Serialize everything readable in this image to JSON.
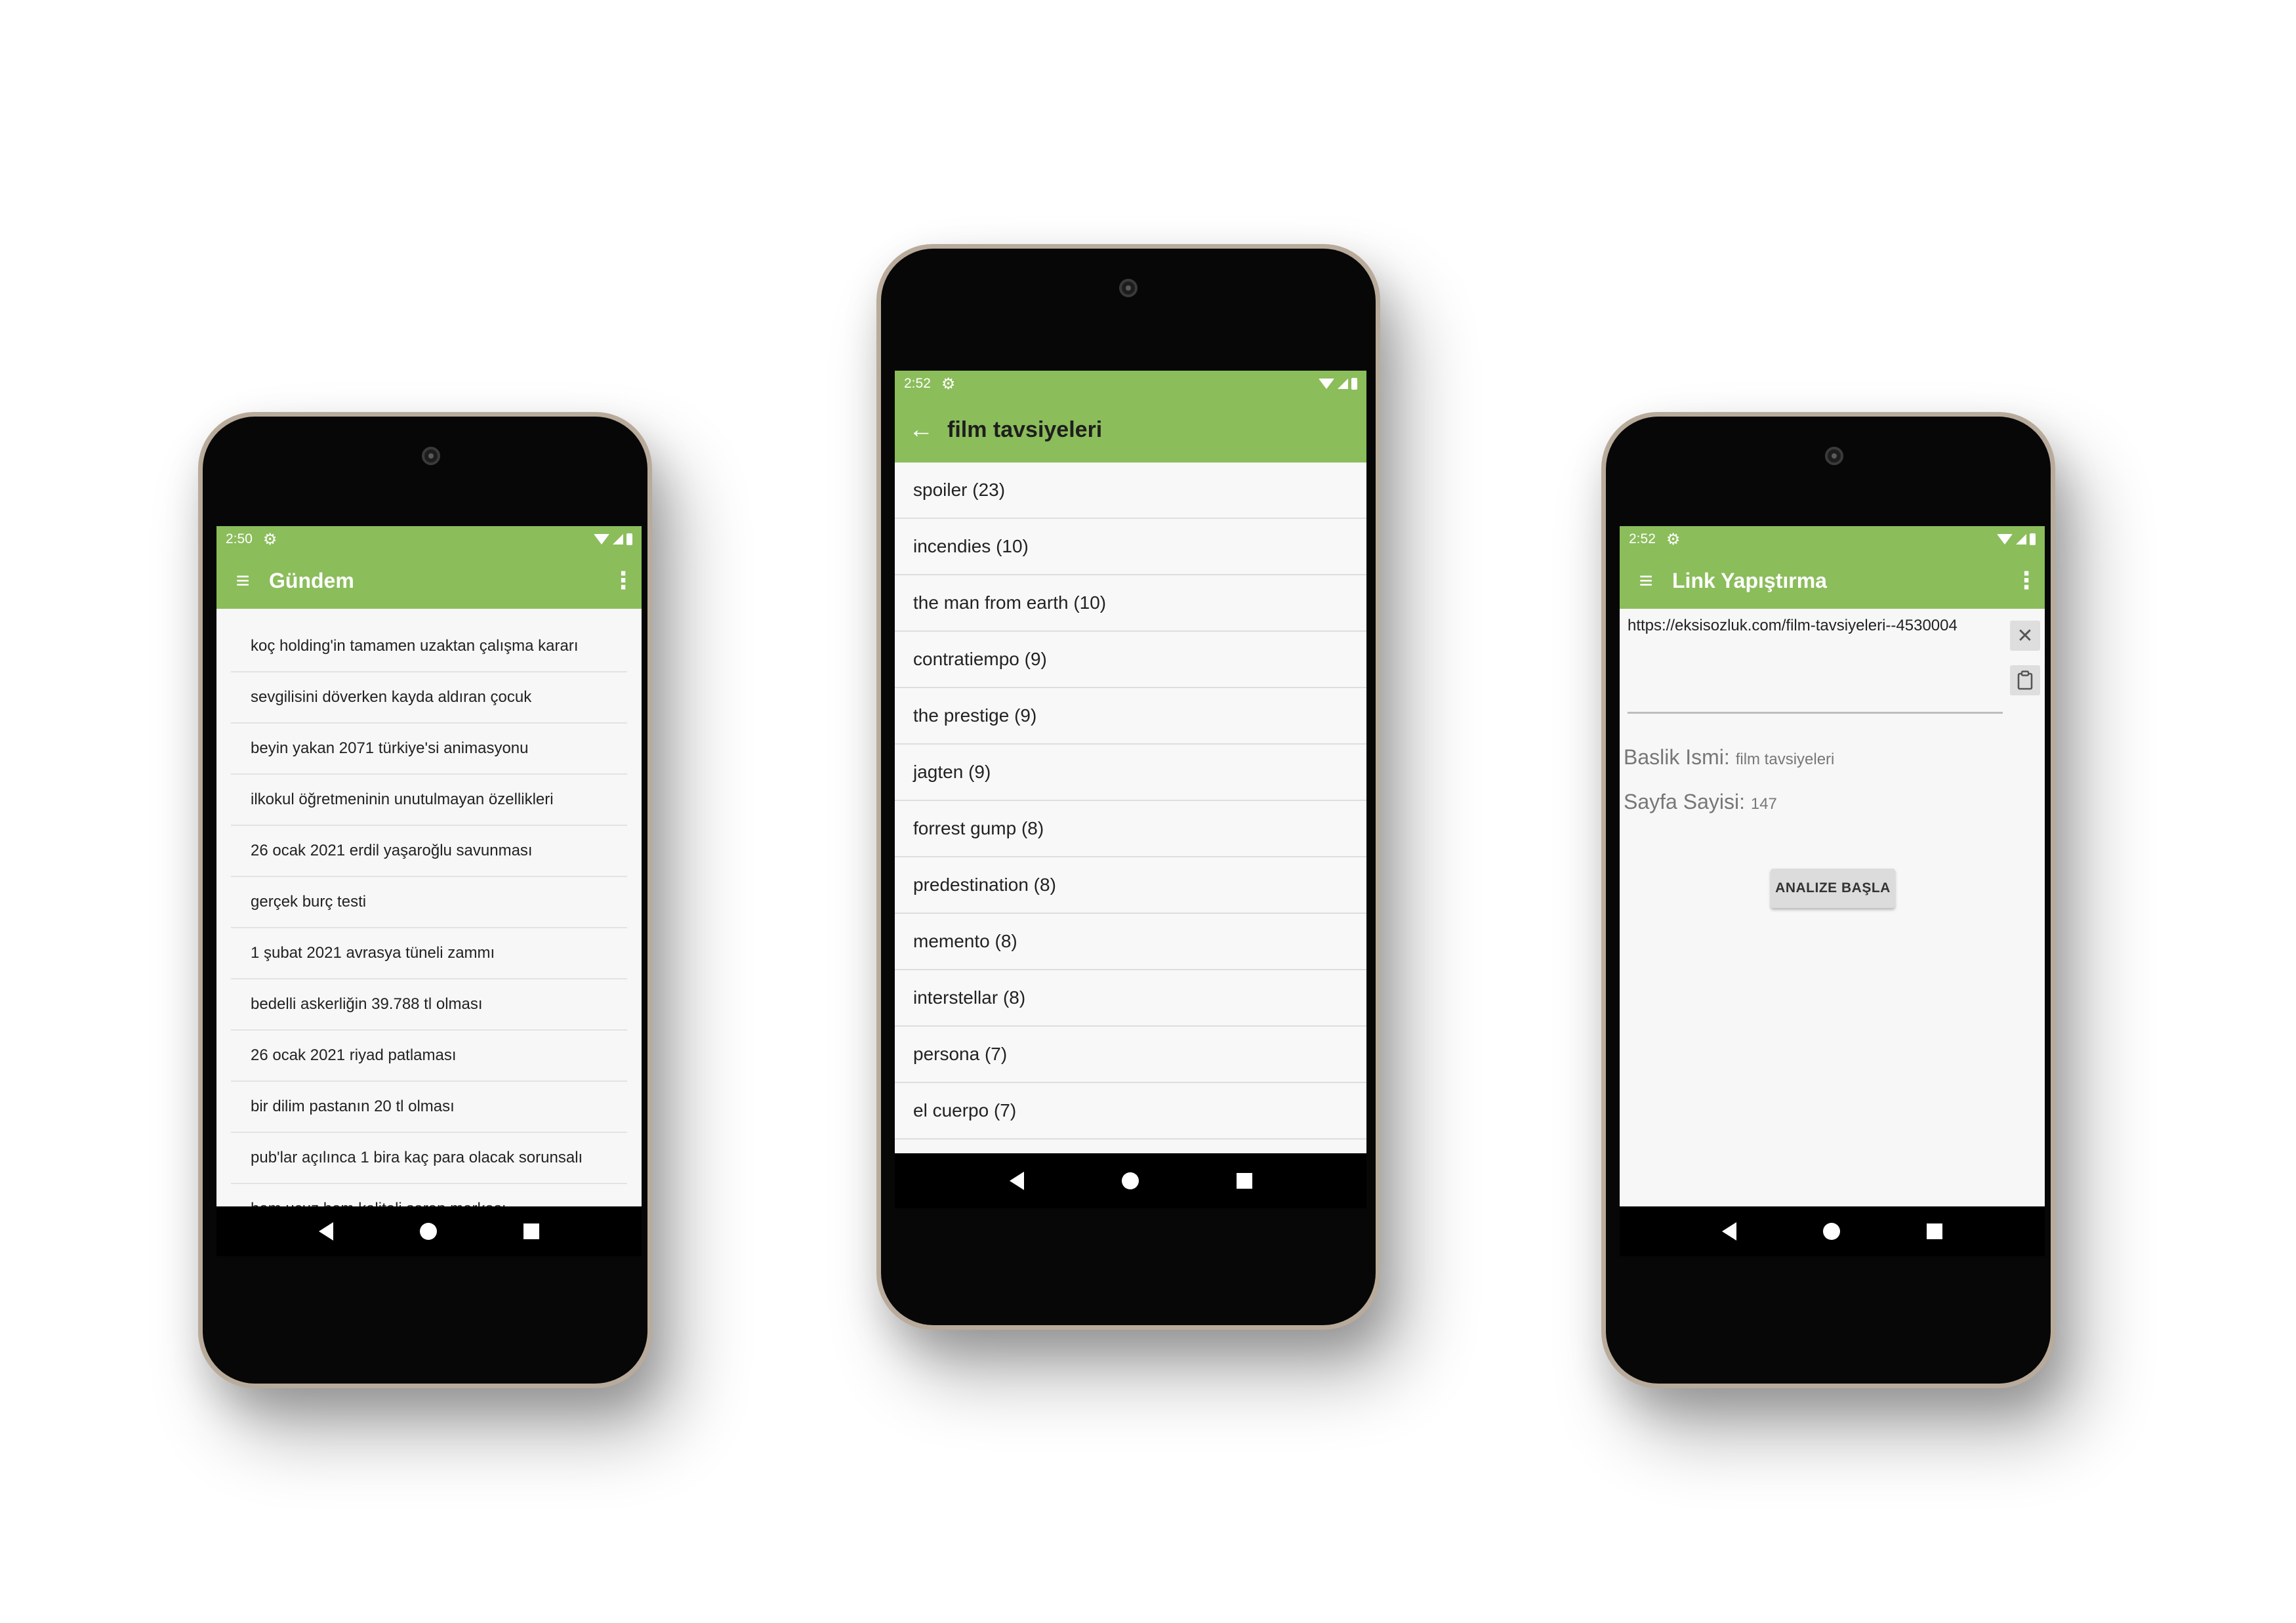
{
  "phone1": {
    "status": {
      "time": "2:50"
    },
    "appbar": {
      "title": "Gündem"
    },
    "topics": [
      "koç holding'in tamamen uzaktan çalışma kararı",
      "sevgilisini döverken kayda aldıran çocuk",
      "beyin yakan 2071 türkiye'si animasyonu",
      "ilkokul öğretmeninin unutulmayan özellikleri",
      "26 ocak 2021 erdil yaşaroğlu savunması",
      "gerçek burç testi",
      "1 şubat 2021 avrasya tüneli zammı",
      "bedelli askerliğin 39.788 tl olması",
      "26 ocak 2021 riyad patlaması",
      "bir dilim pastanın 20 tl olması",
      "pub'lar açılınca 1 bira kaç para olacak sorunsalı",
      "hem ucuz hem kaliteli şarap markası"
    ]
  },
  "phone2": {
    "status": {
      "time": "2:52"
    },
    "appbar": {
      "title": "film tavsiyeleri"
    },
    "films": [
      "spoiler (23)",
      "incendies (10)",
      "the man from earth (10)",
      "contratiempo (9)",
      "the prestige (9)",
      "jagten (9)",
      "forrest gump (8)",
      "predestination (8)",
      "memento (8)",
      "interstellar (8)",
      "persona (7)",
      "el cuerpo (7)"
    ]
  },
  "phone3": {
    "status": {
      "time": "2:52"
    },
    "appbar": {
      "title": "Link Yapıştırma"
    },
    "url_value": "https://eksisozluk.com/film-tavsiyeleri--4530004",
    "baslik_label": "Baslik Ismi:",
    "baslik_value": "film tavsiyeleri",
    "sayfa_label": "Sayfa Sayisi:",
    "sayfa_value": "147",
    "analyze_label": "ANALIZE BAŞLA"
  },
  "icons": {
    "menu": "hamburger-icon",
    "more": "more-vert-icon",
    "back": "arrow-back-icon",
    "clear": "close-icon",
    "paste": "clipboard-icon",
    "settings": "gear-icon"
  },
  "colors": {
    "appbar": "#8bbd5b",
    "navbar": "#000000",
    "screen_bg": "#f7f7f7",
    "button_bg": "#dcdcdc"
  }
}
